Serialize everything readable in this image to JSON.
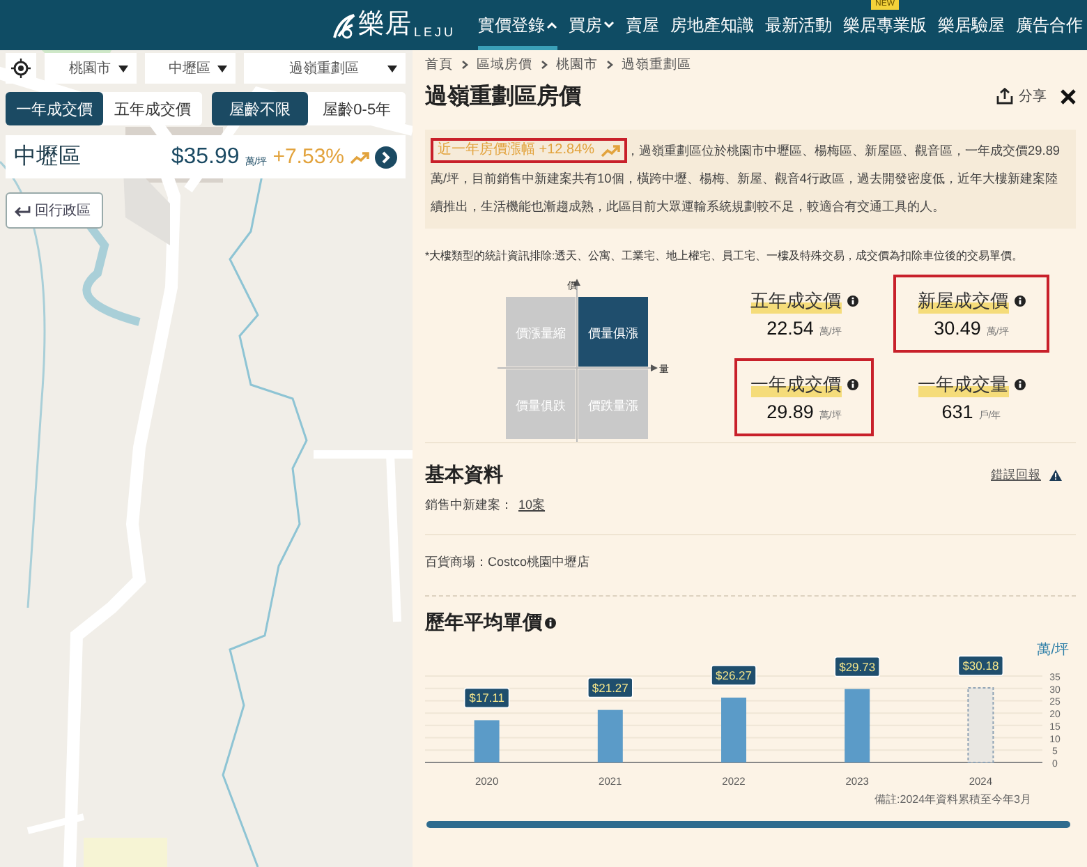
{
  "header": {
    "logo_text": "樂居",
    "logo_latin": "LEJU",
    "nav": [
      {
        "label": "實價登錄",
        "dropdown": true,
        "selected": true
      },
      {
        "label": "買房",
        "dropdown": true,
        "selected": false
      },
      {
        "label": "賣屋",
        "dropdown": false,
        "selected": false
      },
      {
        "label": "房地產知識",
        "dropdown": false,
        "selected": false
      },
      {
        "label": "最新活動",
        "dropdown": false,
        "selected": false
      },
      {
        "label": "樂居專業版",
        "dropdown": false,
        "selected": false,
        "badge": "NEW"
      },
      {
        "label": "樂居驗屋",
        "dropdown": false,
        "selected": false
      },
      {
        "label": "廣告合作",
        "dropdown": false,
        "selected": false
      }
    ]
  },
  "map": {
    "selects": [
      "桃園市",
      "中壢區",
      "過嶺重劃區"
    ],
    "price_tabs": [
      {
        "label": "一年成交價",
        "selected": true
      },
      {
        "label": "五年成交價",
        "selected": false
      }
    ],
    "age_tabs": [
      {
        "label": "屋齡不限",
        "selected": true
      },
      {
        "label": "屋齡0-5年",
        "selected": false
      }
    ],
    "summary": {
      "district": "中壢區",
      "price": "$35.99",
      "unit": "萬/坪",
      "change": "+7.53%"
    },
    "back_button": "回行政區"
  },
  "detail": {
    "breadcrumb": [
      "首頁",
      "區域房價",
      "桃園市",
      "過嶺重劃區"
    ],
    "title": "過嶺重劃區房價",
    "share": "分享",
    "trend_badge": {
      "text": "近一年房價漲幅 +12.84%",
      "highlighted": true
    },
    "description_lead": "，過嶺重劃區位於桃園市中壢區、楊梅區、新屋區、觀音區，一年成交價29.89",
    "description": "萬/坪，目前銷售中新建案共有10個，橫跨中壢、楊梅、新屋、觀音4行政區，過去開發密度低，近年大樓新建案陸續推出，生活機能也漸趨成熟，此區目前大眾運輸系統規劃較不足，較適合有交通工具的人。",
    "note": "*大樓類型的統計資訊排除:透天、公寓、工業宅、地上權宅、員工宅、一樓及特殊交易，成交價為扣除車位後的交易單價。",
    "axis_price": "價",
    "axis_volume": "量",
    "quadrants": [
      {
        "label": "價漲量縮",
        "selected": false
      },
      {
        "label": "價量俱漲",
        "selected": true
      },
      {
        "label": "價量俱跌",
        "selected": false
      },
      {
        "label": "價跌量漲",
        "selected": false
      }
    ],
    "stats": [
      {
        "title": "五年成交價",
        "value": "22.54",
        "unit": "萬/坪",
        "highlighted": false
      },
      {
        "title": "新屋成交價",
        "value": "30.49",
        "unit": "萬/坪",
        "highlighted": true
      },
      {
        "title": "一年成交價",
        "value": "29.89",
        "unit": "萬/坪",
        "highlighted": true
      },
      {
        "title": "一年成交量",
        "value": "631",
        "unit": "戶/年",
        "highlighted": false
      }
    ],
    "basic": {
      "title": "基本資料",
      "report_link": "錯誤回報",
      "new_projects_label": "銷售中新建案：",
      "new_projects_link": "10案",
      "mall": "百貨商場：Costco桃園中壢店"
    },
    "history": {
      "title": "歷年平均單價",
      "chart_data": {
        "type": "bar",
        "ylabel": "萬/坪",
        "categories": [
          "2020",
          "2021",
          "2022",
          "2023",
          "2024"
        ],
        "stacked": true,
        "series": [
          {
            "color": "#5b9bc8",
            "values": [
              17.11,
              21.27,
              26.27,
              29.73,
              null
            ]
          },
          {
            "color": "#e9e7e2",
            "values": [
              null,
              null,
              null,
              null,
              30.18
            ]
          }
        ],
        "grid": true,
        "ylim": [
          0,
          35
        ],
        "yticks": [
          0,
          5,
          10,
          15,
          20,
          25,
          30,
          35
        ],
        "value_labels": [
          "$17.11",
          "$21.27",
          "$26.27",
          "$29.73",
          "$30.18"
        ]
      },
      "footnote": "備註:2024年資料累積至今年3月"
    }
  }
}
